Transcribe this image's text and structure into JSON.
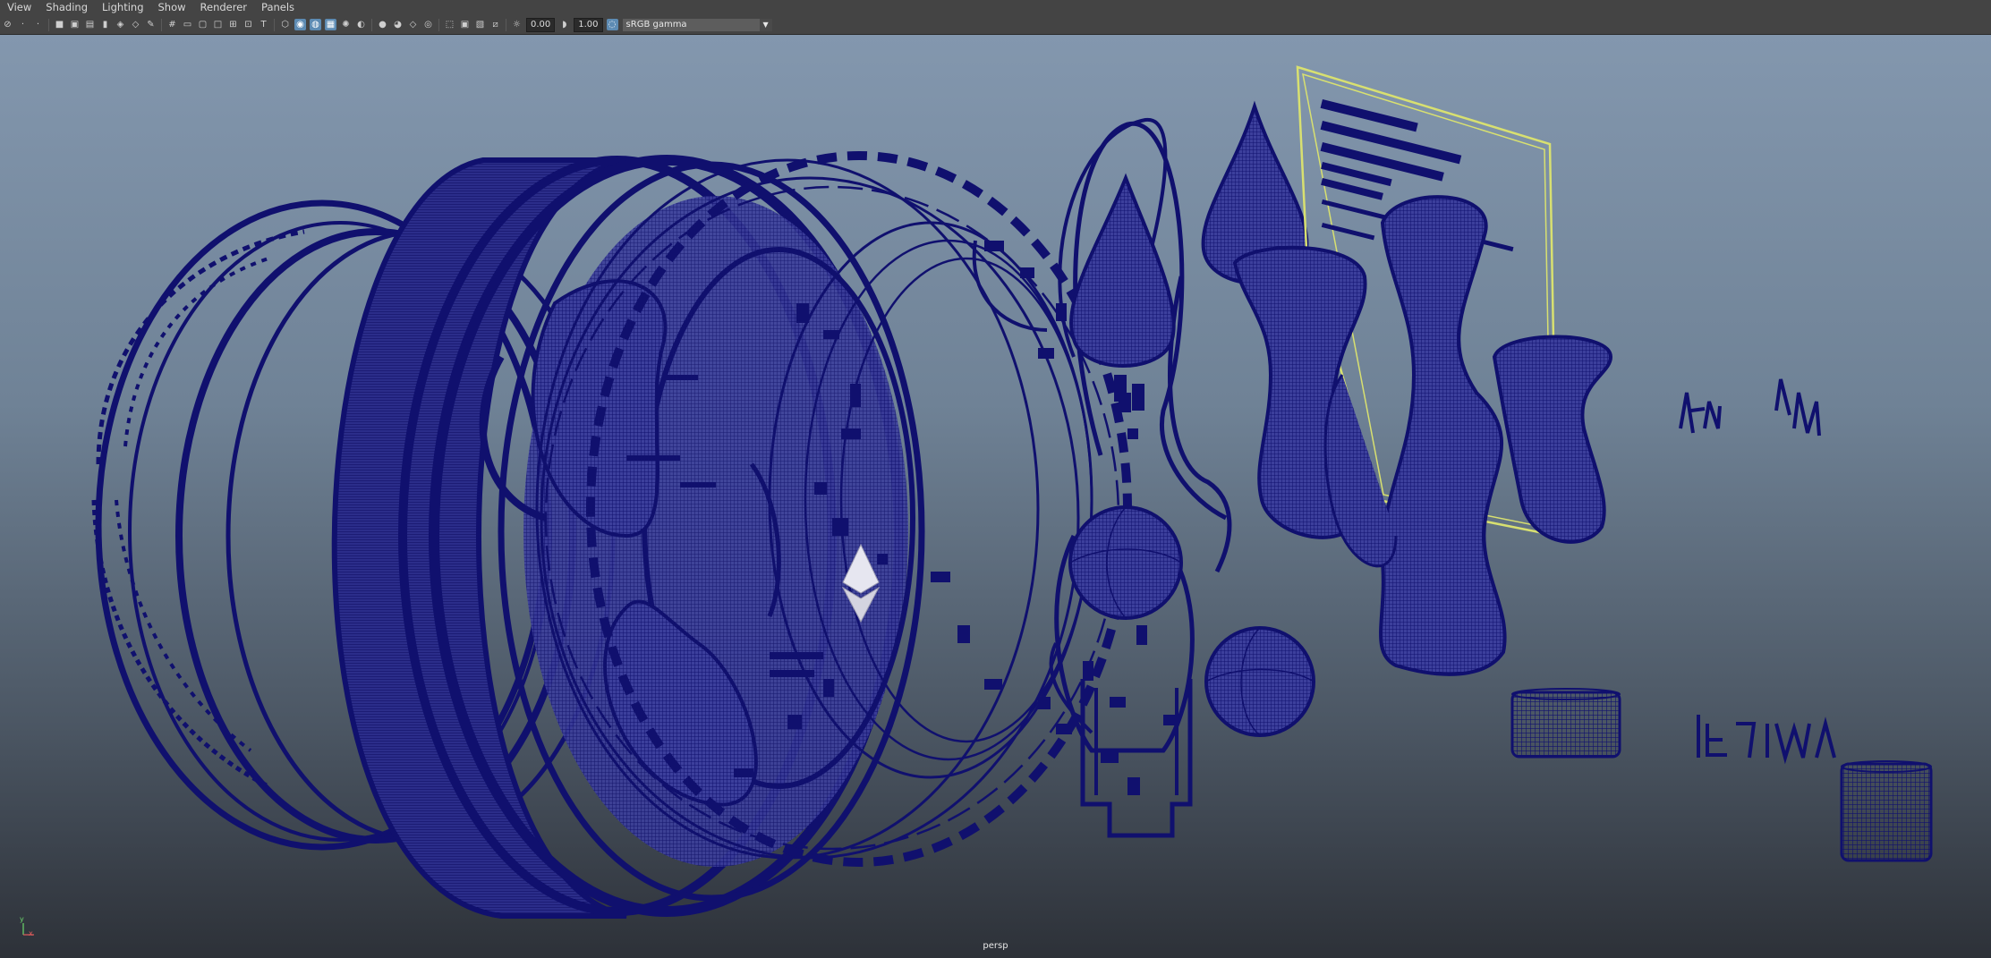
{
  "menu": {
    "items": [
      "View",
      "Shading",
      "Lighting",
      "Show",
      "Renderer",
      "Panels"
    ]
  },
  "toolbar": {
    "exposure_value": "0.00",
    "gamma_value": "1.00",
    "color_space": "sRGB gamma"
  },
  "viewport": {
    "camera_label": "persp",
    "wire_color": "#10106e",
    "axis_y_label": "y",
    "axis_x_label": "x"
  }
}
